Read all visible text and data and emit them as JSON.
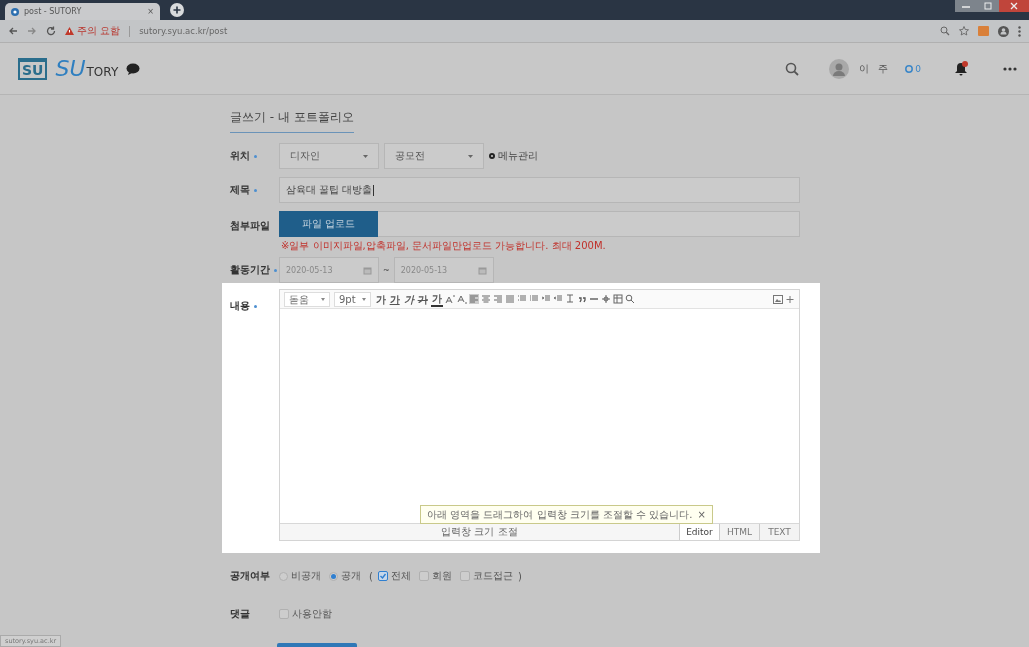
{
  "browser": {
    "tab_title": "post - SUTORY",
    "tab_close": "×",
    "warning": "주의 요함",
    "url": "sutory.syu.ac.kr/post"
  },
  "header": {
    "logo_mark": "SU",
    "logo_accent": "SU",
    "logo_rest": "TORY",
    "user_name": "이 주",
    "message_count": "0"
  },
  "page_title": "글쓰기 - 내 포트폴리오",
  "fields": [
    {
      "kind": "select",
      "label": "위치",
      "required": true,
      "options": [
        "디자인",
        "공모전"
      ],
      "link": "메뉴관리"
    },
    {
      "kind": "text",
      "label": "제목",
      "required": true,
      "value": "삼육대 꿀팁 대방출"
    },
    {
      "kind": "file",
      "label": "첨부파일",
      "required": false,
      "button": "파일 업로드",
      "note": "※일부 이미지파일,압축파일, 문서파일만업로드 가능합니다. 최대 200M."
    },
    {
      "kind": "date_range",
      "label": "활동기간",
      "required": true,
      "start": "2020-05-13",
      "separator": "~",
      "end": "2020-05-13"
    },
    {
      "kind": "editor",
      "label": "내용",
      "required": true,
      "font": "돋움",
      "size": "9pt",
      "format_buttons": [
        "가",
        "가",
        "가",
        "가",
        "가"
      ],
      "tooltip": "아래 영역을 드래그하여 입력창 크기를 조절할 수 있습니다.",
      "tooltip_close": "×",
      "resize": "입력창 크기 조절",
      "modes": [
        {
          "label": "Editor",
          "selected": true
        },
        {
          "label": "HTML",
          "selected": false
        },
        {
          "label": "TEXT",
          "selected": false
        }
      ]
    },
    {
      "kind": "visibility",
      "label": "공개여부",
      "required": false,
      "options": [
        {
          "label": "비공개",
          "selected": false
        },
        {
          "label": "공개",
          "selected": true
        }
      ],
      "open_paren": "(",
      "scopes": [
        {
          "label": "전체",
          "checked": true
        },
        {
          "label": "회원",
          "checked": false
        },
        {
          "label": "코드접근",
          "checked": false
        }
      ],
      "close_paren": ")"
    },
    {
      "kind": "checkbox",
      "label": "댓글",
      "required": false,
      "option": {
        "label": "사용안함",
        "checked": false
      }
    }
  ],
  "status_url": "sutory.syu.ac.kr"
}
